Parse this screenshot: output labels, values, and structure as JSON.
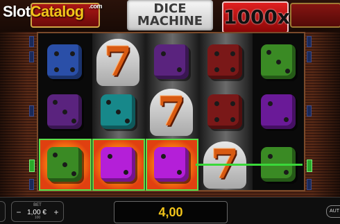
{
  "header": {
    "logo_part1": "Slot",
    "logo_part2": "Catalog",
    "logo_suffix": ".com",
    "title_line1": "DICE",
    "title_line2": "MACHINE",
    "multiplier": "1000x"
  },
  "reels": [
    [
      "blue-die-4",
      "purple-dark-die-3",
      "green-die-3"
    ],
    [
      "seven",
      "teal-die-3",
      "magenta-die-2"
    ],
    [
      "purple-dark-die-2",
      "seven",
      "magenta-die-2"
    ],
    [
      "red-die-4",
      "red-die-4",
      "seven"
    ],
    [
      "green-die-3",
      "violet-die-2",
      "green-die-2"
    ]
  ],
  "win_row": 3,
  "win_reels": [
    1,
    2,
    3
  ],
  "controls": {
    "bet_label": "BET",
    "bet_value": "1,00 €",
    "bet_sub": "100",
    "bet_minus": "−",
    "bet_plus": "+",
    "win_amount": "4,00",
    "auto_label": "AUT"
  },
  "colors": {
    "payline": "#3ad83a",
    "win_text": "#f2c41a",
    "multiplier_bg": "#c81414"
  }
}
